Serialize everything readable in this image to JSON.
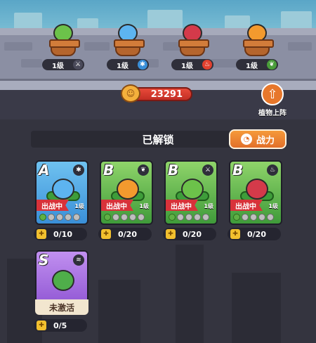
{
  "lineup": [
    {
      "level": "1级",
      "element": "sword-icon",
      "element_glyph": "⚔",
      "element_color": "#4a4a5a",
      "plant_color": "#6cc24a"
    },
    {
      "level": "1级",
      "element": "snowflake-icon",
      "element_glyph": "✱",
      "element_color": "#3a8fd8",
      "plant_color": "#5db4f0"
    },
    {
      "level": "1级",
      "element": "fire-icon",
      "element_glyph": "♨",
      "element_color": "#e2402e",
      "plant_color": "#d43a4a"
    },
    {
      "level": "1级",
      "element": "leaf-icon",
      "element_glyph": "❦",
      "element_color": "#4a9d3a",
      "plant_color": "#f39a2e"
    }
  ],
  "coins": "23291",
  "plant_up_label": "植物上阵",
  "unlocked_title": "已解锁",
  "power_button": "战力",
  "cards": [
    {
      "rank": "A",
      "element": "snowflake-icon",
      "element_glyph": "✱",
      "status": "出战中",
      "level": "1级",
      "progress": "0/10",
      "bg": "bg-a",
      "plant_color": "#5db4f0"
    },
    {
      "rank": "B",
      "element": "leaf-icon",
      "element_glyph": "❦",
      "status": "出战中",
      "level": "1级",
      "progress": "0/20",
      "bg": "bg-b",
      "plant_color": "#f39a2e"
    },
    {
      "rank": "B",
      "element": "sword-icon",
      "element_glyph": "⚔",
      "status": "出战中",
      "level": "1级",
      "progress": "0/20",
      "bg": "bg-b",
      "plant_color": "#6cc24a"
    },
    {
      "rank": "B",
      "element": "fire-icon",
      "element_glyph": "♨",
      "status": "出战中",
      "level": "1级",
      "progress": "0/20",
      "bg": "bg-b",
      "plant_color": "#d43a4a"
    }
  ],
  "inactive_card": {
    "rank": "S",
    "element": "wind-icon",
    "element_glyph": "≋",
    "status": "未激活",
    "progress": "0/5",
    "plant_color": "#4fae4a"
  }
}
